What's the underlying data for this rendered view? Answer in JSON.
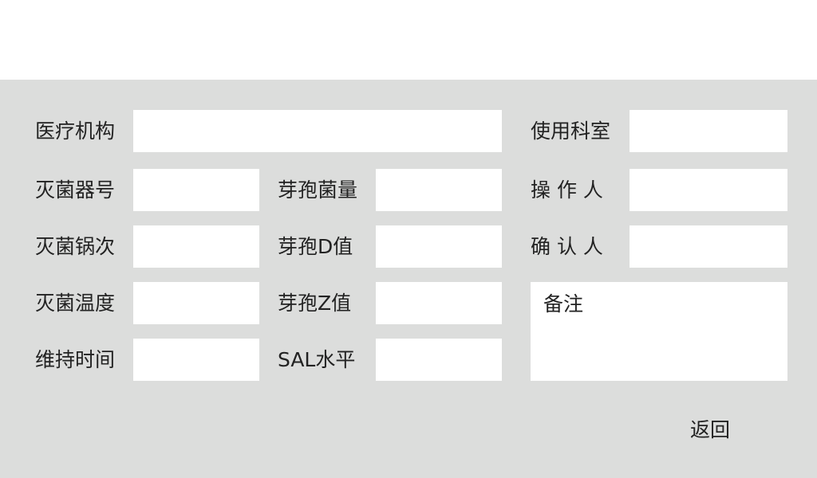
{
  "form": {
    "medical_institution": {
      "label": "医疗机构",
      "value": ""
    },
    "department": {
      "label": "使用科室",
      "value": ""
    },
    "sterilizer_no": {
      "label": "灭菌器号",
      "value": ""
    },
    "spore_count": {
      "label": "芽孢菌量",
      "value": ""
    },
    "operator": {
      "label": "操 作 人",
      "value": ""
    },
    "sterilizer_batch": {
      "label": "灭菌锅次",
      "value": ""
    },
    "spore_d_value": {
      "label": "芽孢D值",
      "value": ""
    },
    "confirmer": {
      "label": "确 认 人",
      "value": ""
    },
    "sterilization_temp": {
      "label": "灭菌温度",
      "value": ""
    },
    "spore_z_value": {
      "label": "芽孢Z值",
      "value": ""
    },
    "hold_time": {
      "label": "维持时间",
      "value": ""
    },
    "sal_level": {
      "label": "SAL水平",
      "value": ""
    },
    "notes": {
      "placeholder": "备注",
      "value": ""
    }
  },
  "actions": {
    "back_label": "返回"
  }
}
